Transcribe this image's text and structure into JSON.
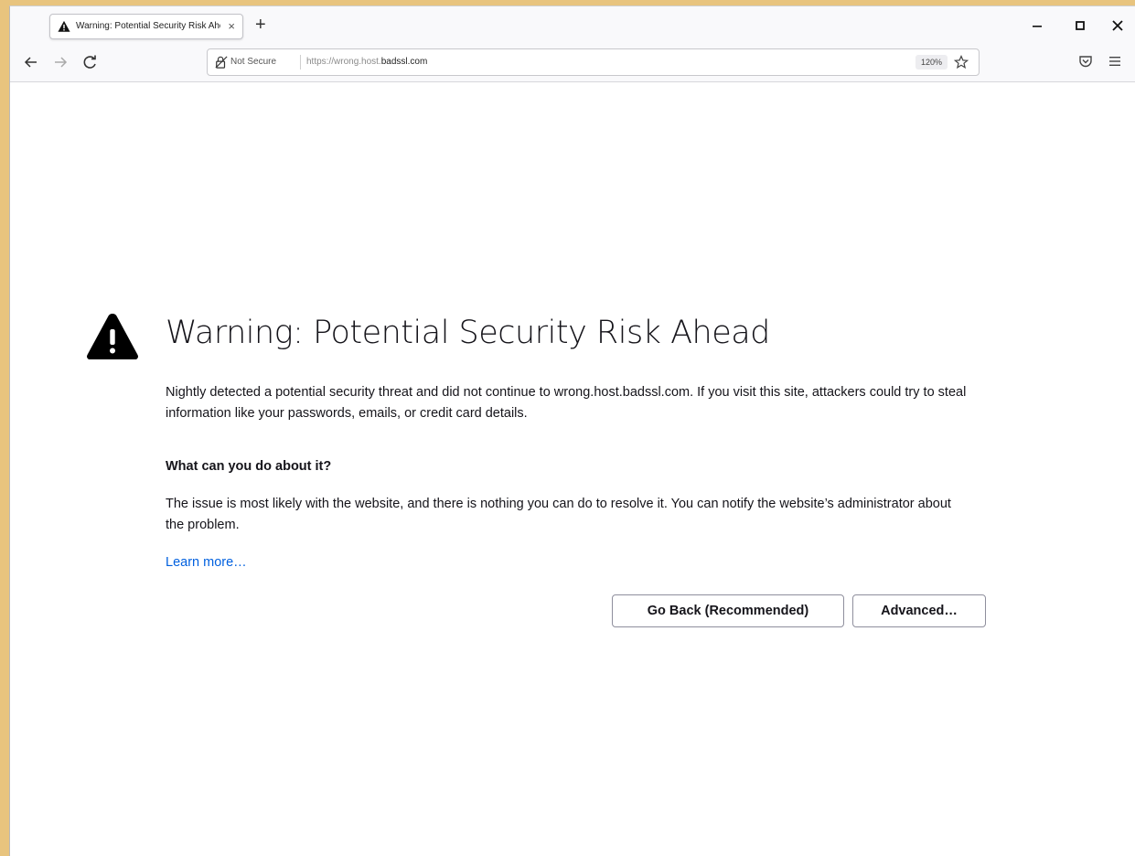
{
  "browser": {
    "tab": {
      "title": "Warning: Potential Security Risk Ahead",
      "close_label": "×",
      "icon": "warning-icon"
    },
    "new_tab_label": "+",
    "window_controls": [
      "minimize-icon",
      "maximize-icon",
      "close-icon"
    ],
    "nav": {
      "back_icon": "back-arrow-icon",
      "forward_icon": "forward-arrow-icon",
      "reload_icon": "reload-icon"
    },
    "urlbar": {
      "security_label": "Not Secure",
      "url_prefix": "https://wrong.host.",
      "url_domain": "badssl.com",
      "zoom": "120%"
    }
  },
  "page": {
    "title": "Warning: Potential Security Risk Ahead",
    "intro": "Nightly detected a potential security threat and did not continue to wrong.host.badssl.com. If you visit this site, attackers could try to steal information like your passwords, emails, or credit card details.",
    "subtitle": "What can you do about it?",
    "advice": "The issue is most likely with the website, and there is nothing you can do to resolve it. You can notify the website’s administrator about the problem.",
    "learn_more": "Learn more…",
    "go_back_button": "Go Back (Recommended)",
    "advanced_button": "Advanced…"
  },
  "colors": {
    "desktop": "#e8c47e",
    "link": "#0060df",
    "text": "#15141a"
  }
}
